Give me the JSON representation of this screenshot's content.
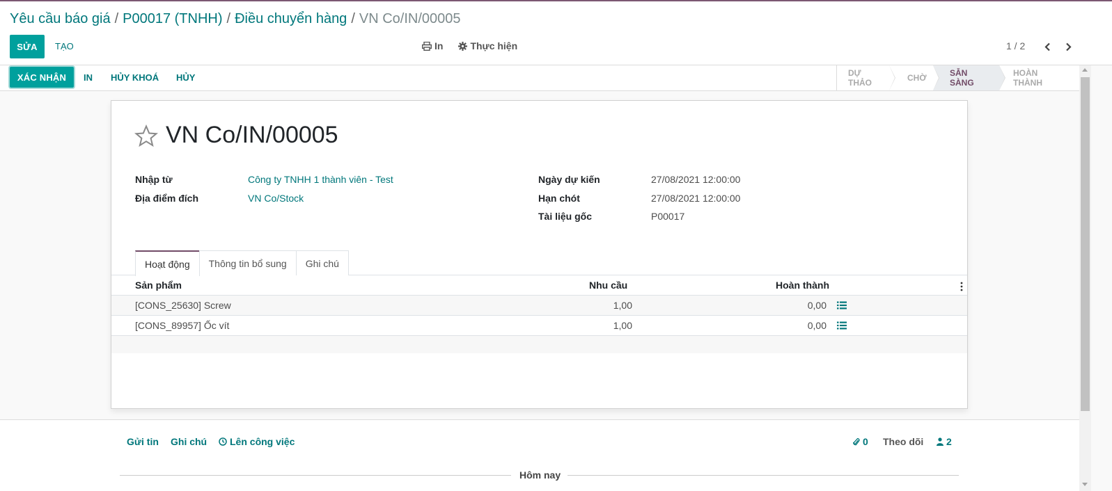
{
  "breadcrumb": {
    "items": [
      "Yêu cầu báo giá",
      "P00017 (TNHH)",
      "Điều chuyển hàng"
    ],
    "current": "VN Co/IN/00005"
  },
  "toolbar": {
    "edit_label": "SỬA",
    "create_label": "TẠO",
    "print_label": "In",
    "action_label": "Thực hiện",
    "pager": "1 / 2"
  },
  "statusbar": {
    "buttons": [
      "XÁC NHẬN",
      "IN",
      "HỦY KHOÁ",
      "HỦY"
    ],
    "stages": [
      "DỰ THẢO",
      "CHỜ",
      "SẴN SÀNG",
      "HOÀN THÀNH"
    ],
    "active_stage": "SẴN SÀNG"
  },
  "form": {
    "title": "VN Co/IN/00005",
    "fields_left": [
      {
        "label": "Nhập từ",
        "value": "Công ty TNHH 1 thành viên - Test"
      },
      {
        "label": "Địa điểm đích",
        "value": "VN Co/Stock"
      }
    ],
    "fields_right": [
      {
        "label": "Ngày dự kiến",
        "value": "27/08/2021 12:00:00"
      },
      {
        "label": "Hạn chót",
        "value": "27/08/2021 12:00:00"
      },
      {
        "label": "Tài liệu gốc",
        "value": "P00017"
      }
    ],
    "tabs": [
      "Hoạt động",
      "Thông tin bổ sung",
      "Ghi chú"
    ],
    "active_tab": "Hoạt động"
  },
  "table": {
    "columns": [
      "Sản phẩm",
      "Nhu cầu",
      "Hoàn thành"
    ],
    "rows": [
      {
        "product": "[CONS_25630] Screw",
        "demand": "1,00",
        "done": "0,00"
      },
      {
        "product": "[CONS_89957] Ốc vít",
        "demand": "1,00",
        "done": "0,00"
      }
    ]
  },
  "chatter": {
    "send_message": "Gửi tin",
    "log_note": "Ghi chú",
    "schedule_activity": "Lên công việc",
    "attachments": "0",
    "follow": "Theo dõi",
    "followers": "2",
    "today": "Hôm nay"
  },
  "colors": {
    "primary": "#00a09d",
    "link": "#00777b",
    "brand": "#714b67"
  }
}
